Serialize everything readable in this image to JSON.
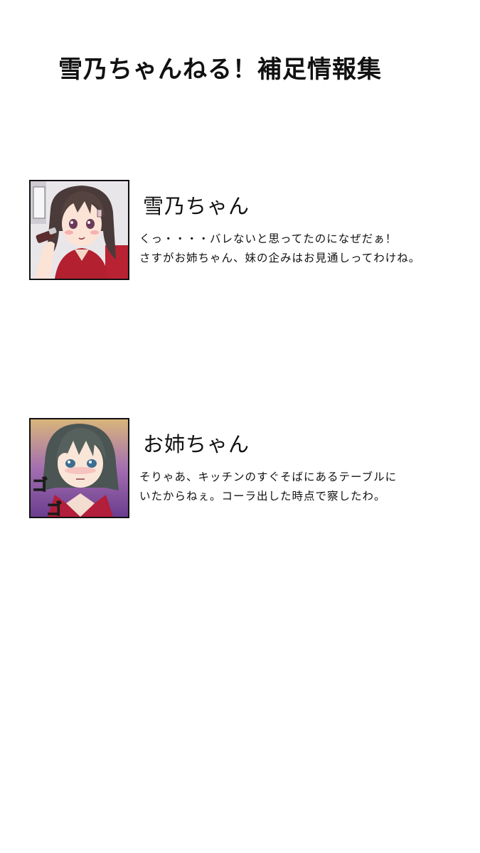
{
  "page": {
    "title": "雪乃ちゃんねる！補足情報集"
  },
  "characters": [
    {
      "name": "雪乃ちゃん",
      "lines": [
        "くっ・・・・バレないと思ってたのになぜだぁ！",
        "さすがお姉ちゃん、妹の企みはお見通しってわけね。"
      ]
    },
    {
      "name": "お姉ちゃん",
      "lines": [
        "そりゃあ、キッチンのすぐそばにあるテーブルに",
        "いたからねぇ。コーラ出した時点で察したわ。"
      ]
    }
  ],
  "colors": {
    "text": "#111111",
    "background": "#ffffff",
    "sfx_green": "#4cc24a"
  }
}
